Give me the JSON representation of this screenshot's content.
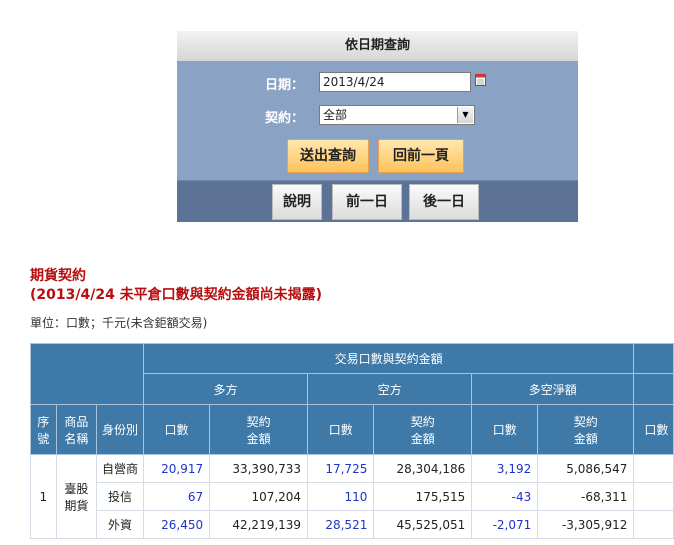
{
  "query": {
    "header": "依日期查詢",
    "date_label": "日期：",
    "date_value": "2013/4/24",
    "contract_label": "契約：",
    "contract_value": "全部",
    "submit_label": "送出查詢",
    "back_label": "回前一頁",
    "help_label": "說明",
    "prev_day_label": "前一日",
    "next_day_label": "後一日"
  },
  "headings": {
    "title": "期貨契約",
    "subtitle": "(2013/4/24 未平倉口數與契約金額尚未揭露)",
    "unit": "單位：口數；千元(未含鉅額交易)"
  },
  "table": {
    "group_header": "交易口數與契約金額",
    "long_header": "多方",
    "short_header": "空方",
    "net_header": "多空淨額",
    "col_seq": "序號",
    "col_product": "商品名稱",
    "col_identity": "身份別",
    "col_lots": "口數",
    "col_amount": "契約金額",
    "extra_col_partial": "口數",
    "seq": "1",
    "product": "臺股期貨",
    "rows": [
      {
        "identity": "自營商",
        "long_lots": "20,917",
        "long_amt": "33,390,733",
        "short_lots": "17,725",
        "short_amt": "28,304,186",
        "net_lots": "3,192",
        "net_amt": "5,086,547"
      },
      {
        "identity": "投信",
        "long_lots": "67",
        "long_amt": "107,204",
        "short_lots": "110",
        "short_amt": "175,515",
        "net_lots": "-43",
        "net_amt": "-68,311"
      },
      {
        "identity": "外資",
        "long_lots": "26,450",
        "long_amt": "42,219,139",
        "short_lots": "28,521",
        "short_amt": "45,525,051",
        "net_lots": "-2,071",
        "net_amt": "-3,305,912"
      }
    ]
  },
  "colors": {
    "panel_bg": "#8aa3c4",
    "panel_bottom": "#5d7396",
    "table_header": "#3e79a8",
    "title_red": "#b70f0f",
    "link_blue": "#1f33c9",
    "orange_button": "#ffc35a"
  }
}
